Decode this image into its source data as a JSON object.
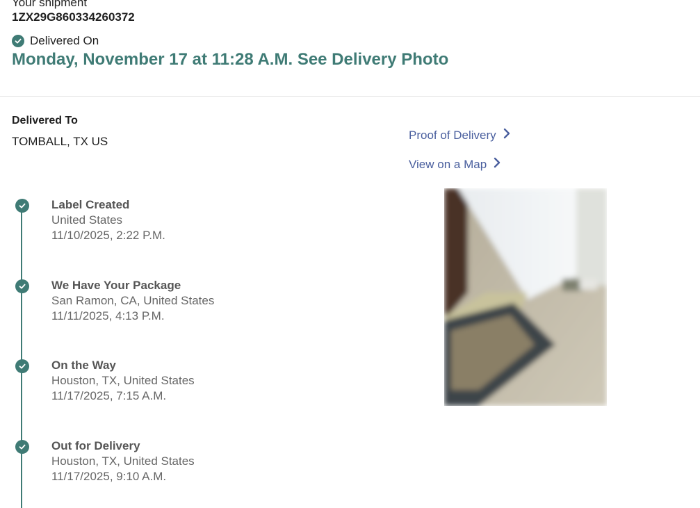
{
  "header": {
    "shipment_caption": "Your shipment",
    "tracking_number": "1ZX29G860334260372",
    "status_label": "Delivered On",
    "delivery_datetime": "Monday, November 17 at 11:28 A.M.",
    "photo_link": "See Delivery Photo"
  },
  "delivered_to": {
    "label": "Delivered To",
    "value": "TOMBALL, TX US"
  },
  "links": {
    "proof_of_delivery": "Proof of Delivery",
    "view_on_map": "View on a Map"
  },
  "events": [
    {
      "title": "Label Created",
      "location": "United States",
      "datetime": "11/10/2025, 2:22 P.M."
    },
    {
      "title": "We Have Your Package",
      "location": "San Ramon, CA, United States",
      "datetime": "11/11/2025, 4:13 P.M."
    },
    {
      "title": "On the Way",
      "location": "Houston, TX, United States",
      "datetime": "11/17/2025, 7:15 A.M."
    },
    {
      "title": "Out for Delivery",
      "location": "Houston, TX, United States",
      "datetime": "11/17/2025, 9:10 A.M."
    }
  ],
  "colors": {
    "accent": "#3f7b75",
    "link": "#4a5f9e"
  }
}
